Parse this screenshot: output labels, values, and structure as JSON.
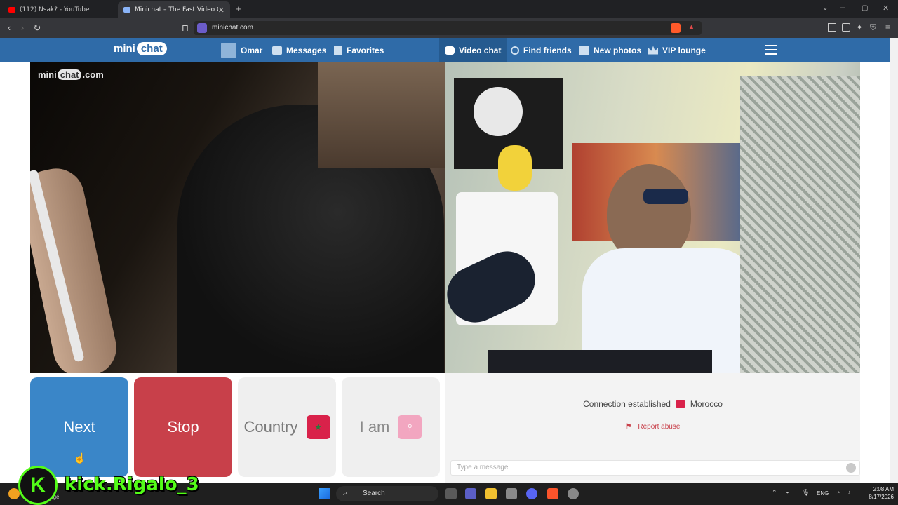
{
  "browser": {
    "tabs": [
      {
        "title": "(112) Nsak? - YouTube",
        "active": false,
        "favicon_color": "#ff0000"
      },
      {
        "title": "Minichat – The Fast Video Ch",
        "active": true,
        "favicon_color": "#8ab4f8"
      }
    ],
    "url": "minichat.com"
  },
  "site": {
    "logo": {
      "mini": "mini",
      "chat": "chat"
    },
    "nav_left": [
      {
        "label": "Omar",
        "icon": "user-avatar-icon"
      },
      {
        "label": "Messages",
        "icon": "envelope-icon"
      },
      {
        "label": "Favorites",
        "icon": "bookmark-icon"
      }
    ],
    "nav_right": [
      {
        "label": "Video chat",
        "icon": "video-chat-icon",
        "active": true
      },
      {
        "label": "Find friends",
        "icon": "search-icon"
      },
      {
        "label": "New photos",
        "icon": "grid-icon"
      },
      {
        "label": "VIP lounge",
        "icon": "crown-icon"
      }
    ],
    "watermark": {
      "mini": "mini",
      "chat": "chat",
      "dotcom": ".com"
    },
    "controls": {
      "next": "Next",
      "stop": "Stop",
      "country": "Country",
      "i_am": "I am"
    },
    "status": {
      "connection": "Connection established",
      "country": "Morocco",
      "report": "Report abuse"
    },
    "message_placeholder": "Type a message"
  },
  "taskbar": {
    "search_placeholder": "Search",
    "lang": "ENG",
    "time": "2:08 AM",
    "date": "8/17/2026",
    "weather_text": "emps dégagé"
  },
  "overlay": {
    "streamer": "kick.Rigalo_3"
  },
  "colors": {
    "header": "#2f6ba8",
    "next": "#3a86c8",
    "stop": "#c8404a",
    "flag_red": "#d9224a"
  }
}
